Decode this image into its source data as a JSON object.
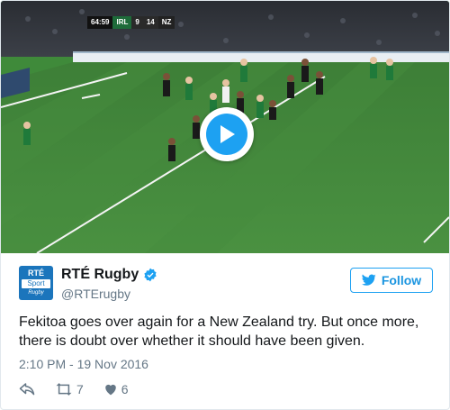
{
  "video": {
    "scoreboard": {
      "clock": "64:59",
      "home_team": "IRL",
      "home_score": "9",
      "away_score": "14",
      "away_team": "NZ"
    },
    "play_icon": "play-icon"
  },
  "tweet": {
    "display_name": "RTÉ Rugby",
    "handle": "@RTErugby",
    "avatar": {
      "line1": "RTÉ",
      "line2": "Sport",
      "line3": "Rugby"
    },
    "follow_label": "Follow",
    "text": "Fekitoa goes over again for a New Zealand try. But once more, there is doubt over whether it should have been given.",
    "timestamp": "2:10 PM - 19 Nov 2016",
    "retweet_count": "7",
    "like_count": "6"
  },
  "colors": {
    "accent": "#1da1f2",
    "pitch": "#3f8a3a"
  }
}
